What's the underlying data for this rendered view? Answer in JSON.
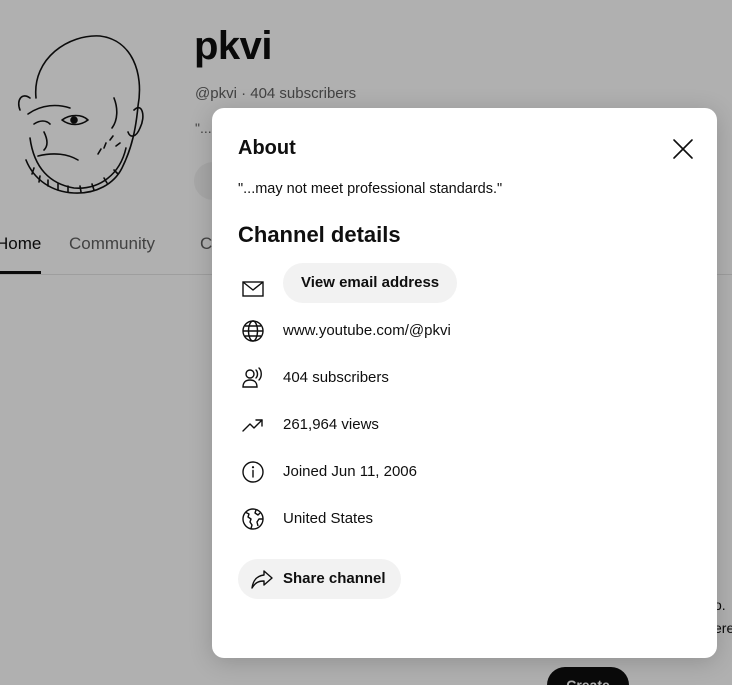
{
  "channel": {
    "name": "pkvi",
    "meta": "@pkvi · 404 subscribers",
    "description_snippet": "\"..."
  },
  "tabs": [
    {
      "label": "Home"
    },
    {
      "label": "Community"
    },
    {
      "label": "C"
    }
  ],
  "background": {
    "side_text_1": "o.",
    "side_text_2": "ere",
    "create_label": "Create"
  },
  "modal": {
    "title": "About",
    "description": "\"...may not meet professional standards.\"",
    "details_heading": "Channel details",
    "email_button": "View email address",
    "url": "www.youtube.com/@pkvi",
    "subscribers": "404 subscribers",
    "views": "261,964 views",
    "joined": "Joined Jun 11, 2006",
    "country": "United States",
    "share_button": "Share channel",
    "icons": {
      "email": "mail-icon",
      "url": "globe-icon",
      "subscribers": "subscribers-icon",
      "views": "trending-icon",
      "joined": "info-icon",
      "country": "world-icon",
      "share": "share-icon",
      "close": "close-icon"
    }
  }
}
